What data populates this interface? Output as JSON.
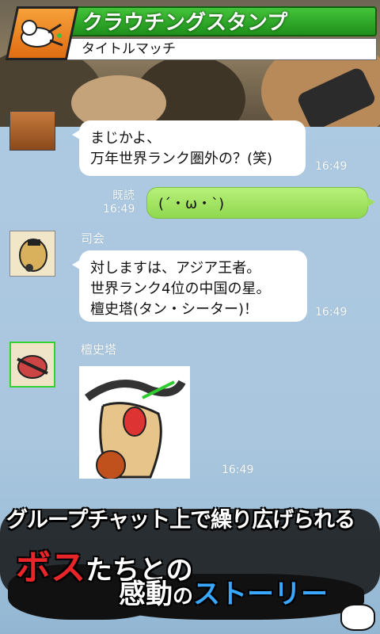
{
  "header": {
    "title": "クラウチングスタンプ",
    "subtitle": "タイトルマッチ",
    "logo_icon": "crouching-man-icon",
    "colors": {
      "title_green": "#2aa52a",
      "logo_orange": "#ef8a25"
    }
  },
  "messages": [
    {
      "type": "left",
      "lines": [
        "まじかよ、",
        "万年世界ランク圏外の？(笑)"
      ],
      "time": "16:49"
    },
    {
      "type": "right",
      "text": "(´・ω・`)",
      "read": "既読",
      "time": "16:49"
    },
    {
      "type": "left",
      "sender": "司会",
      "lines": [
        "対しますは、アジア王者。",
        "世界ランク4位の中国の星。",
        "檀史塔(タン・シーター)！"
      ],
      "time": "16:49"
    },
    {
      "type": "sticker",
      "sender": "檀史塔",
      "time": "16:49"
    }
  ],
  "promo": {
    "line1": "グループチャット上で繰り広げられる",
    "line2_red": "ボス",
    "line2_rest": "たちとの",
    "line3_a": "感動",
    "line3_b": "の",
    "line3_c": "ストーリー",
    "colors": {
      "red": "#e8262a",
      "blue": "#3aa7ff"
    }
  }
}
